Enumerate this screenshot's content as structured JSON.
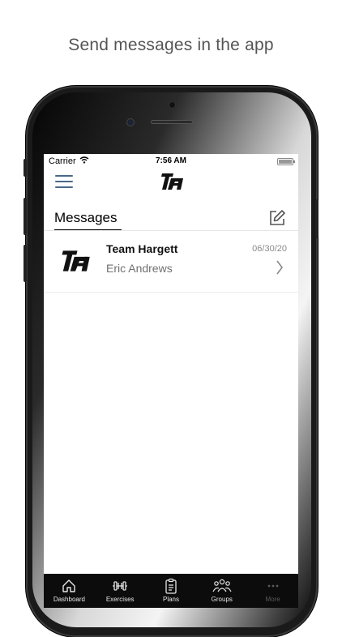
{
  "caption": "Send messages in the app",
  "status_bar": {
    "carrier": "Carrier",
    "time": "7:56 AM"
  },
  "header": {
    "title": "Messages"
  },
  "messages": [
    {
      "name": "Team Hargett",
      "subtitle": "Eric Andrews",
      "date": "06/30/20"
    }
  ],
  "tabbar": {
    "items": [
      {
        "label": "Dashboard",
        "icon": "home-icon"
      },
      {
        "label": "Exercises",
        "icon": "dumbbell-icon"
      },
      {
        "label": "Plans",
        "icon": "clipboard-icon"
      },
      {
        "label": "Groups",
        "icon": "groups-icon"
      },
      {
        "label": "More",
        "icon": "more-icon"
      }
    ]
  },
  "colors": {
    "accent": "#4a6a8a",
    "tabbar_bg": "#0c0c0c"
  }
}
